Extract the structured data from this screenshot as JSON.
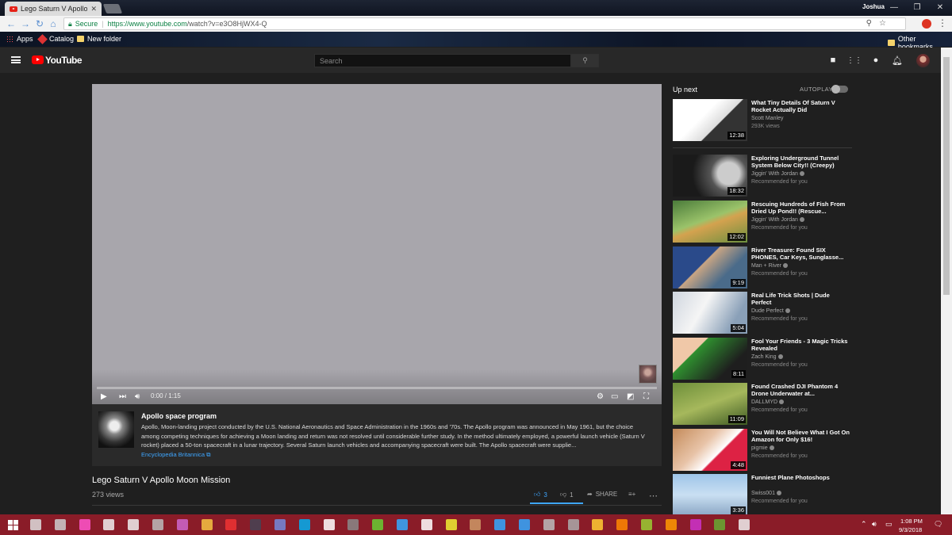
{
  "browser": {
    "tab_title": "Lego Saturn V Apollo Mo",
    "profile_name": "Joshua",
    "url_secure_label": "Secure",
    "url_scheme_host": "https://www.youtube.com",
    "url_path": "/watch?v=e3O8HjWX4-Q",
    "bookmarks": [
      "Apps",
      "Catalog",
      "New folder"
    ],
    "other_bookmarks": "Other bookmarks"
  },
  "masthead": {
    "logo_text": "YouTube",
    "search_placeholder": "Search"
  },
  "player": {
    "time": "0:00 / 1:15",
    "progress_fraction": 0.0
  },
  "info_panel": {
    "title": "Apollo space program",
    "text": "Apollo, Moon-landing project conducted by the U.S. National Aeronautics and Space Administration in the 1960s and '70s. The Apollo program was announced in May 1961, but the choice among competing techniques for achieving a Moon landing and return was not resolved until considerable further study. In the method ultimately employed, a powerful launch vehicle (Saturn V rocket) placed a 50-ton spacecraft in a lunar trajectory. Several Saturn launch vehicles and accompanying spacecraft were built. The Apollo spacecraft were supplie...",
    "source": "Encyclopedia Britannica"
  },
  "video": {
    "title": "Lego Saturn V Apollo Moon Mission",
    "views": "273 views",
    "likes": "3",
    "dislikes": "1",
    "share_label": "SHARE"
  },
  "upnext": {
    "label": "Up next",
    "autoplay_label": "AUTOPLAY",
    "items": [
      {
        "title": "What Tiny Details Of Saturn V Rocket Actually Did",
        "channel": "Scott Manley",
        "meta": "293K views",
        "duration": "12:38",
        "verified": false
      },
      {
        "title": "Exploring Underground Tunnel System Below City!! (Creepy)",
        "channel": "Jiggin' With Jordan",
        "meta": "Recommended for you",
        "duration": "18:32",
        "verified": true
      },
      {
        "title": "Rescuing Hundreds of Fish From Dried Up Pond!! (Rescue...",
        "channel": "Jiggin' With Jordan",
        "meta": "Recommended for you",
        "duration": "12:02",
        "verified": true
      },
      {
        "title": "River Treasure: Found SIX PHONES, Car Keys, Sunglasse...",
        "channel": "Man + River",
        "meta": "Recommended for you",
        "duration": "9:19",
        "verified": true
      },
      {
        "title": "Real Life Trick Shots | Dude Perfect",
        "channel": "Dude Perfect",
        "meta": "Recommended for you",
        "duration": "5:04",
        "verified": true
      },
      {
        "title": "Fool Your Friends - 3 Magic Tricks Revealed",
        "channel": "Zach King",
        "meta": "Recommended for you",
        "duration": "8:11",
        "verified": true
      },
      {
        "title": "Found Crashed DJI Phantom 4 Drone Underwater at...",
        "channel": "DALLMYD",
        "meta": "Recommended for you",
        "duration": "11:09",
        "verified": true
      },
      {
        "title": "You Will Not Believe What I Got On Amazon for Only $16!",
        "channel": "pigmie",
        "meta": "Recommended for you",
        "duration": "4:48",
        "verified": true
      },
      {
        "title": "Funniest Plane Photoshops",
        "channel": "Swiss001",
        "meta": "Recommended for you",
        "duration": "3:36",
        "verified": true
      }
    ]
  },
  "taskbar": {
    "time": "1:08 PM",
    "date": "9/3/2018"
  }
}
